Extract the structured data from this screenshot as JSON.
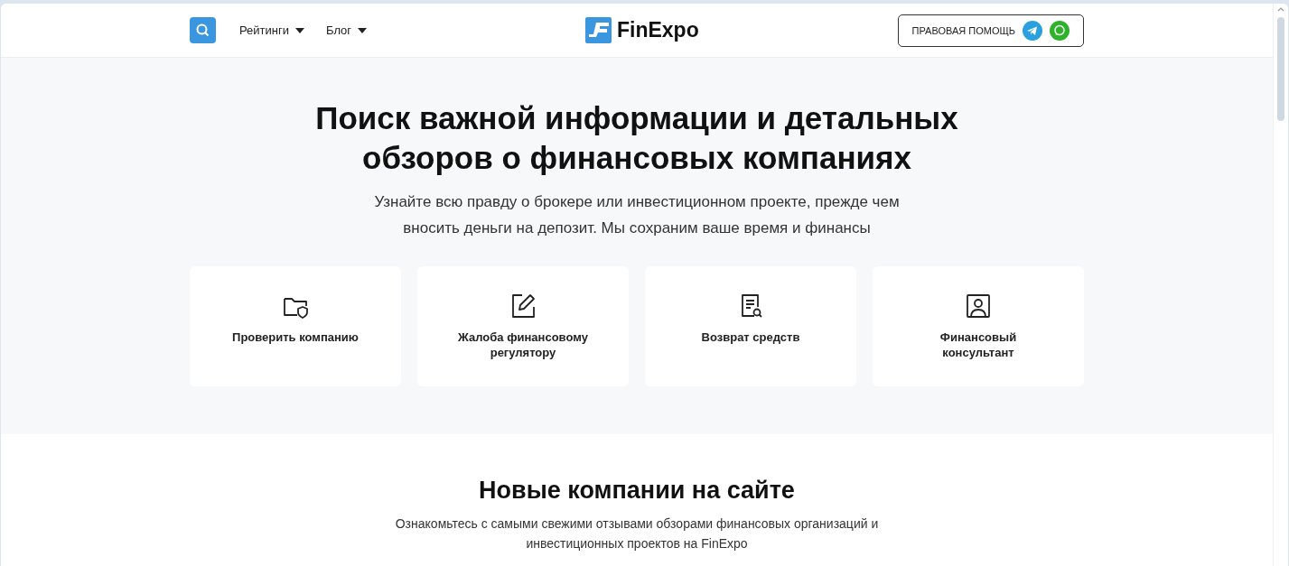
{
  "header": {
    "nav": [
      {
        "label": "Рейтинги"
      },
      {
        "label": "Блог"
      }
    ],
    "logo": "FinExpo",
    "help_button": "ПРАВОВАЯ ПОМОЩЬ"
  },
  "hero": {
    "title": "Поиск важной информации и детальных обзоров о финансовых компаниях",
    "subtitle": "Узнайте всю правду о брокере или инвестиционном проекте, прежде чем вносить деньги на депозит. Мы сохраним ваше время и финансы",
    "cards": [
      {
        "kind": "folder",
        "label": "Проверить компанию"
      },
      {
        "kind": "edit",
        "label": "Жалоба финансовому регулятору"
      },
      {
        "kind": "document",
        "label": "Возврат средств"
      },
      {
        "kind": "person",
        "label": "Финансовый консультант"
      }
    ]
  },
  "new_companies": {
    "title": "Новые компании на сайте",
    "text": "Ознакомьтесь с самыми свежими отзывами обзорами финансовых организаций и инвестиционных проектов на FinExpo"
  }
}
